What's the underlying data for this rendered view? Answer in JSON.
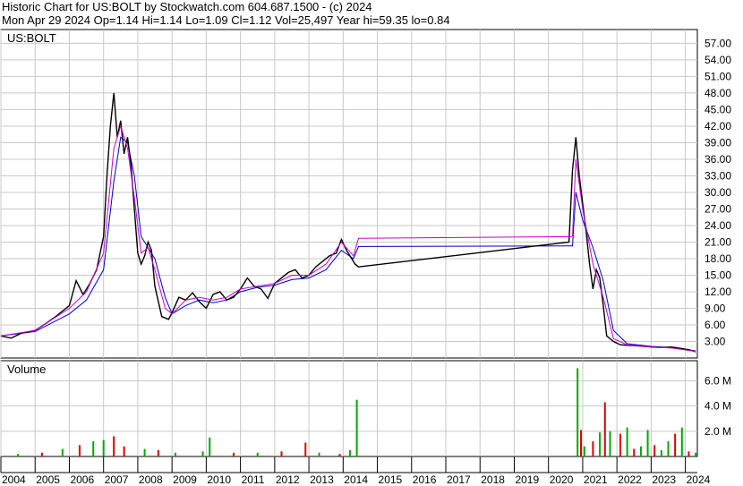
{
  "header": {
    "title_line": "Historic Chart for US:BOLT by Stockwatch.com 604.687.1500 - (c) 2024",
    "quote_line": "Mon Apr 29 2024   Op=1.14  Hi=1.14  Lo=1.09  Cl=1.12  Vol=25,497  Year hi=59.35  lo=0.84"
  },
  "price_panel": {
    "symbol_label": "US:BOLT"
  },
  "volume_panel": {
    "label": "Volume"
  },
  "colors": {
    "price": "#000000",
    "ma_short": "#cc00cc",
    "ma_long": "#0000cc",
    "vol_up": "#00aa00",
    "vol_down": "#dd0000",
    "grid": "#c8c8c8",
    "frame": "#000000"
  },
  "chart_data": [
    {
      "type": "line",
      "title": "Historic Chart for US:BOLT",
      "xlabel": "",
      "ylabel": "",
      "y_ticks": [
        "3.00",
        "6.00",
        "9.00",
        "12.00",
        "15.00",
        "18.00",
        "21.00",
        "24.00",
        "27.00",
        "30.00",
        "33.00",
        "36.00",
        "39.00",
        "42.00",
        "45.00",
        "48.00",
        "51.00",
        "54.00",
        "57.00"
      ],
      "ylim": [
        0,
        59.5
      ],
      "x_ticks": [
        "2004",
        "2005",
        "2006",
        "2007",
        "2008",
        "2009",
        "2010",
        "2011",
        "2012",
        "2013",
        "2014",
        "2015",
        "2016",
        "2017",
        "2018",
        "2019",
        "2020",
        "2021",
        "2022",
        "2023",
        "2024"
      ],
      "xlim": [
        2004.0,
        2024.35
      ],
      "grid": true,
      "series": [
        {
          "key": "price",
          "x": [
            2004.0,
            2004.3,
            2004.6,
            2005.0,
            2005.3,
            2005.6,
            2006.0,
            2006.2,
            2006.4,
            2006.6,
            2006.8,
            2007.0,
            2007.1,
            2007.2,
            2007.3,
            2007.4,
            2007.5,
            2007.6,
            2007.7,
            2007.8,
            2007.9,
            2008.0,
            2008.1,
            2008.2,
            2008.3,
            2008.4,
            2008.5,
            2008.7,
            2008.9,
            2009.0,
            2009.2,
            2009.4,
            2009.6,
            2009.8,
            2010.0,
            2010.2,
            2010.4,
            2010.6,
            2010.8,
            2011.0,
            2011.2,
            2011.4,
            2011.6,
            2011.8,
            2012.0,
            2012.2,
            2012.4,
            2012.6,
            2012.8,
            2013.0,
            2013.2,
            2013.4,
            2013.6,
            2013.8,
            2013.95,
            2014.1,
            2014.25,
            2014.35,
            2014.45,
            2020.6,
            2020.7,
            2020.8,
            2020.9,
            2021.0,
            2021.1,
            2021.2,
            2021.3,
            2021.4,
            2021.5,
            2021.6,
            2021.7,
            2021.9,
            2022.1,
            2022.3,
            2022.6,
            2023.0,
            2023.3,
            2023.6,
            2023.9,
            2024.1,
            2024.3
          ],
          "y": [
            4.0,
            3.6,
            4.5,
            5.0,
            6.2,
            7.5,
            9.5,
            14.0,
            11.5,
            13.5,
            16.0,
            22.0,
            33.0,
            42.0,
            48.0,
            40.0,
            43.0,
            37.0,
            40.0,
            35.0,
            27.0,
            19.0,
            17.0,
            18.5,
            21.0,
            19.5,
            13.0,
            7.5,
            7.0,
            8.2,
            11.0,
            10.5,
            11.8,
            10.2,
            9.0,
            11.5,
            12.0,
            10.5,
            11.0,
            12.5,
            14.5,
            13.0,
            12.5,
            10.8,
            13.5,
            14.5,
            15.5,
            16.0,
            14.5,
            15.0,
            16.5,
            17.5,
            18.5,
            19.0,
            21.5,
            19.5,
            18.0,
            17.0,
            16.5,
            21.0,
            34.0,
            40.0,
            33.0,
            28.0,
            23.0,
            17.0,
            12.5,
            16.0,
            14.5,
            9.5,
            4.0,
            3.0,
            2.4,
            2.3,
            2.2,
            2.0,
            1.9,
            2.0,
            1.7,
            1.5,
            1.12
          ]
        },
        {
          "key": "ma_short",
          "x": [
            2004.0,
            2005.0,
            2006.0,
            2006.5,
            2007.0,
            2007.3,
            2007.5,
            2007.7,
            2007.9,
            2008.1,
            2008.3,
            2008.5,
            2008.8,
            2009.0,
            2009.4,
            2009.8,
            2010.2,
            2010.6,
            2011.0,
            2011.5,
            2012.0,
            2012.5,
            2013.0,
            2013.5,
            2013.95,
            2014.3,
            2014.45,
            2020.7,
            2020.8,
            2021.0,
            2021.3,
            2021.6,
            2021.9,
            2022.3,
            2023.0,
            2023.6,
            2024.3
          ],
          "y": [
            4.0,
            5.0,
            9.0,
            12.0,
            19.0,
            38.0,
            42.0,
            38.0,
            29.0,
            19.0,
            20.0,
            16.0,
            9.0,
            8.0,
            10.5,
            11.0,
            10.5,
            11.0,
            12.5,
            13.0,
            13.5,
            15.0,
            15.0,
            17.0,
            21.0,
            18.5,
            21.7,
            22.0,
            36.0,
            27.0,
            17.0,
            11.0,
            3.5,
            2.4,
            2.0,
            1.8,
            1.2
          ]
        },
        {
          "key": "ma_long",
          "x": [
            2004.0,
            2005.0,
            2006.0,
            2006.5,
            2007.0,
            2007.3,
            2007.5,
            2007.7,
            2007.9,
            2008.1,
            2008.3,
            2008.5,
            2008.8,
            2009.0,
            2009.4,
            2009.8,
            2010.2,
            2010.6,
            2011.0,
            2011.5,
            2012.0,
            2012.5,
            2013.0,
            2013.5,
            2013.95,
            2014.3,
            2014.45,
            2020.7,
            2020.8,
            2021.0,
            2021.3,
            2021.6,
            2021.9,
            2022.3,
            2023.0,
            2023.6,
            2024.3
          ],
          "y": [
            4.0,
            4.8,
            8.0,
            10.5,
            16.0,
            32.0,
            40.0,
            39.0,
            33.0,
            22.0,
            20.0,
            18.0,
            11.0,
            8.0,
            9.5,
            10.5,
            10.0,
            10.5,
            12.0,
            12.8,
            13.2,
            14.2,
            14.5,
            16.0,
            19.5,
            18.0,
            20.2,
            20.3,
            30.0,
            25.0,
            20.0,
            14.0,
            5.0,
            2.6,
            2.1,
            1.9,
            1.3
          ]
        }
      ]
    },
    {
      "type": "bar",
      "title": "Volume",
      "y_ticks": [
        "2.0 M",
        "4.0 M",
        "6.0 M"
      ],
      "ylim": [
        0,
        7.6
      ],
      "series": [
        {
          "name": "Volume",
          "x": [
            2004.5,
            2005.2,
            2005.8,
            2006.3,
            2006.7,
            2007.0,
            2007.3,
            2007.6,
            2008.2,
            2008.6,
            2009.1,
            2009.9,
            2010.1,
            2010.8,
            2011.5,
            2012.2,
            2012.9,
            2013.3,
            2013.9,
            2014.2,
            2014.4,
            2020.85,
            2020.95,
            2021.05,
            2021.3,
            2021.5,
            2021.65,
            2021.8,
            2022.1,
            2022.3,
            2022.5,
            2022.7,
            2022.9,
            2023.1,
            2023.3,
            2023.5,
            2023.7,
            2023.9,
            2024.1,
            2024.3
          ],
          "values": [
            0.2,
            0.3,
            0.6,
            0.9,
            1.2,
            1.3,
            1.6,
            0.8,
            0.6,
            0.5,
            0.3,
            0.4,
            1.5,
            0.3,
            0.3,
            0.4,
            1.1,
            0.3,
            0.2,
            0.5,
            4.5,
            7.0,
            2.1,
            0.8,
            1.2,
            1.9,
            4.3,
            2.0,
            1.8,
            2.3,
            0.6,
            0.8,
            2.1,
            0.9,
            0.5,
            1.2,
            1.8,
            2.3,
            0.4,
            0.3
          ],
          "direction": [
            "up",
            "down",
            "up",
            "down",
            "up",
            "up",
            "down",
            "down",
            "up",
            "down",
            "up",
            "up",
            "up",
            "down",
            "up",
            "down",
            "down",
            "up",
            "down",
            "up",
            "up",
            "up",
            "down",
            "up",
            "down",
            "up",
            "down",
            "up",
            "down",
            "up",
            "down",
            "up",
            "up",
            "down",
            "up",
            "up",
            "down",
            "up",
            "down",
            "up"
          ]
        }
      ]
    }
  ]
}
